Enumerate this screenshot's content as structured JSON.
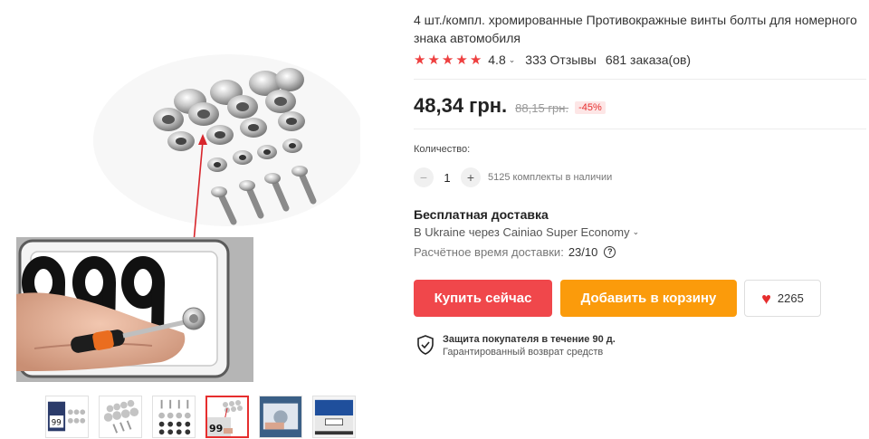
{
  "product": {
    "title": "4 шт./компл. хромированные Противокражные винты болты для номерного знака автомобиля",
    "rating": "4.8",
    "reviews": "333 Отзывы",
    "orders": "681 заказа(ов)"
  },
  "pricing": {
    "price": "48,34 грн.",
    "old_price": "88,15 грн.",
    "discount": "-45%"
  },
  "quantity": {
    "label": "Количество:",
    "minus": "−",
    "value": "1",
    "plus": "+",
    "stock": "5125 комплекты в наличии"
  },
  "shipping": {
    "title": "Бесплатная доставка",
    "method": "В Ukraine через Cainiao Super Economy",
    "time_label": "Расчётное время доставки:",
    "time_value": "23/10",
    "help": "?"
  },
  "actions": {
    "buy": "Купить сейчас",
    "cart": "Добавить в корзину",
    "wishlist_count": "2265"
  },
  "protection": {
    "title": "Защита покупателя в течение 90 д.",
    "subtitle": "Гарантированный возврат средств"
  },
  "gallery": {
    "selected_index": 3,
    "thumbnails": [
      "thumb-installed-plate",
      "thumb-bolts-kit",
      "thumb-bolts-kit-alt",
      "thumb-kit-arrow",
      "thumb-screwdriver-plate",
      "thumb-car-rear"
    ]
  },
  "colors": {
    "accent_red": "#f0474b",
    "accent_orange": "#fb9b0b",
    "star": "#ee3f3f"
  }
}
